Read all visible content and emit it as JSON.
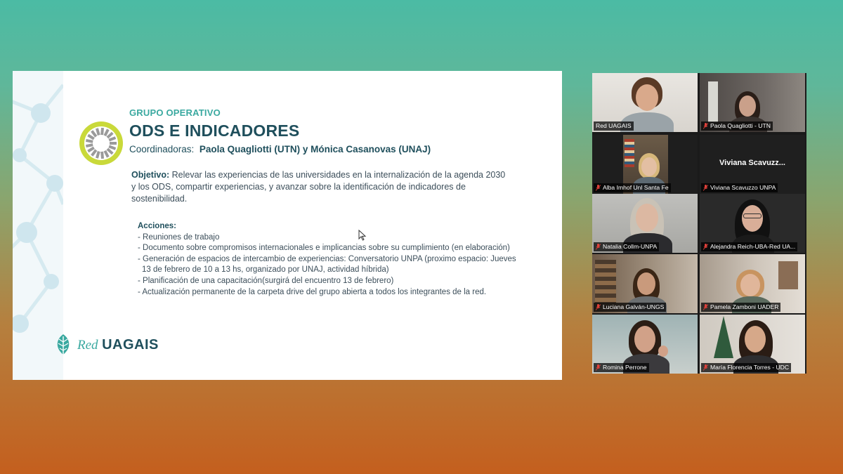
{
  "slide": {
    "subtitle": "GRUPO OPERATIVO",
    "title": "ODS E INDICADORES",
    "coord_label": "Coordinadoras:",
    "coord_names": "Paola Quagliotti (UTN) y Mónica Casanovas (UNAJ)",
    "objective_label": "Objetivo:",
    "objective_lines": [
      " Relevar las experiencias de las universidades en la internalización de la agenda 2030",
      "y los ODS, compartir experiencias, y avanzar sobre la identificación de indicadores de",
      "sostenibilidad."
    ],
    "actions_label": "Acciones:",
    "actions": [
      "- Reuniones de trabajo",
      "- Documento sobre compromisos internacionales e implicancias sobre su cumplimiento (en elaboración)",
      "- Generación de espacios de intercambio de experiencias: Conversatorio UNPA (proximo espacio: Jueves",
      "  13 de febrero de 10 a 13 hs, organizado por UNAJ, actividad híbrida)",
      "- Planificación de una capacitación(surgirá del encuentro 13 de febrero)",
      "- Actualización permanente de la carpeta drive del grupo abierta a todos los integrantes de la red."
    ],
    "brand_prefix": "Red",
    "brand_name": "UAGAIS"
  },
  "participants": [
    {
      "name": "Red UAGAIS",
      "muted": false,
      "active": true
    },
    {
      "name": "Paola Quagliotti - UTN",
      "muted": true,
      "active": false
    },
    {
      "name": "Alba Imhof Unl Santa Fe",
      "muted": true,
      "active": false
    },
    {
      "name": "Viviana Scavuzzo UNPA",
      "muted": true,
      "active": false,
      "display": "Viviana  Scavuzz..."
    },
    {
      "name": "Natalia Collm-UNPA",
      "muted": true,
      "active": false
    },
    {
      "name": "Alejandra Reich-UBA-Red UA...",
      "muted": true,
      "active": false
    },
    {
      "name": "Luciana Galván-UNGS",
      "muted": true,
      "active": false
    },
    {
      "name": "Pamela Zamboni UADER",
      "muted": true,
      "active": false
    },
    {
      "name": "Romina Perrone",
      "muted": true,
      "active": false
    },
    {
      "name": "María Florencia Torres - UDC",
      "muted": true,
      "active": false
    }
  ],
  "colors": {
    "accent_teal": "#3aa9a0",
    "title_dark": "#1f4f5c",
    "active_speaker": "#3ec15b",
    "mute_red": "#e0413a"
  }
}
